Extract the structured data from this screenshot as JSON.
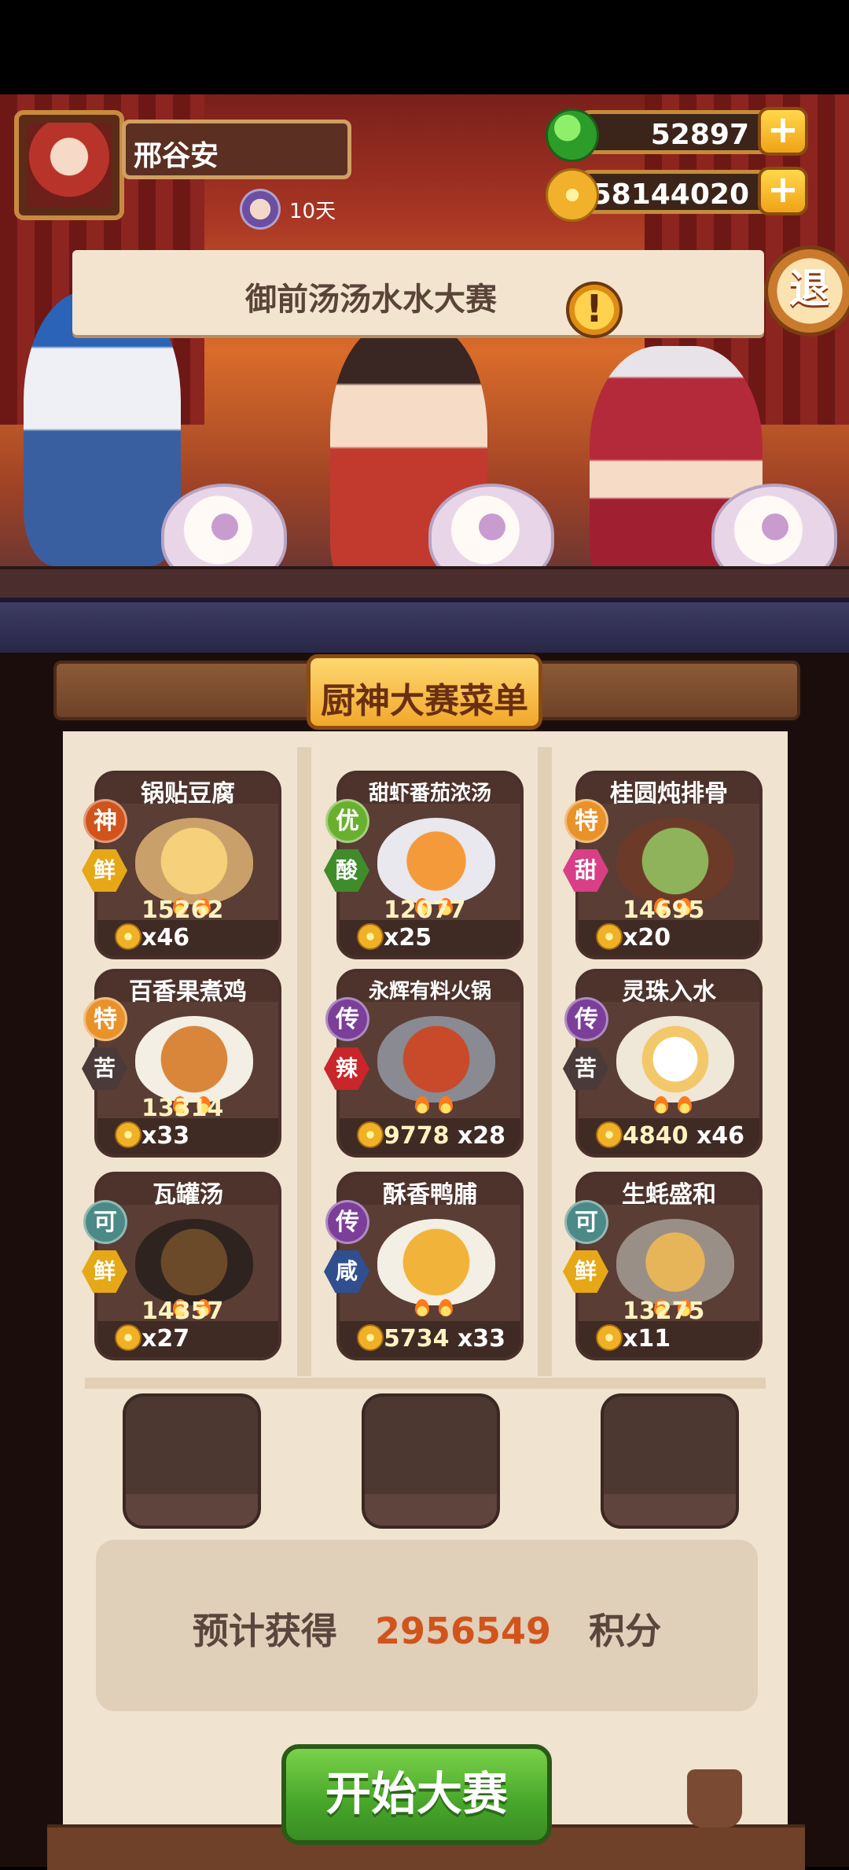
{
  "player": {
    "name": "邢谷安",
    "days": "10天"
  },
  "currency": {
    "jade": "52897",
    "coins": "58144020",
    "plus_label": "+"
  },
  "exit_label": "退",
  "banner": {
    "title": "御前汤汤水水大赛",
    "alert": "!"
  },
  "menu_title": "厨神大赛菜单",
  "dishes": [
    {
      "name": "锅贴豆腐",
      "rank": "神",
      "flavor": "鲜",
      "price": "15262",
      "qty": "x46",
      "rank_color": "#d1541c",
      "flavor_color": "#e6a817"
    },
    {
      "name": "甜虾番茄浓汤",
      "rank": "优",
      "flavor": "酸",
      "price": "12077",
      "qty": "x25",
      "rank_color": "#6ab02f",
      "flavor_color": "#3f8c2a"
    },
    {
      "name": "桂圆炖排骨",
      "rank": "特",
      "flavor": "甜",
      "price": "14695",
      "qty": "x20",
      "rank_color": "#e9922a",
      "flavor_color": "#d83f86"
    },
    {
      "name": "百香果煮鸡",
      "rank": "特",
      "flavor": "苦",
      "price": "13314",
      "qty": "x33",
      "rank_color": "#e9922a",
      "flavor_color": "#4a3b3a"
    },
    {
      "name": "永辉有料火锅",
      "rank": "传",
      "flavor": "辣",
      "price": "9778",
      "qty": "x28",
      "rank_color": "#7b3f9a",
      "flavor_color": "#c8262a"
    },
    {
      "name": "灵珠入水",
      "rank": "传",
      "flavor": "苦",
      "price": "4840",
      "qty": "x46",
      "rank_color": "#7b3f9a",
      "flavor_color": "#4a3b3a"
    },
    {
      "name": "瓦罐汤",
      "rank": "可",
      "flavor": "鲜",
      "price": "14357",
      "qty": "x27",
      "rank_color": "#4b8a86",
      "flavor_color": "#e6a817"
    },
    {
      "name": "酥香鸭脯",
      "rank": "传",
      "flavor": "咸",
      "price": "5734",
      "qty": "x33",
      "rank_color": "#7b3f9a",
      "flavor_color": "#2f4f8f"
    },
    {
      "name": "生蚝盛和",
      "rank": "可",
      "flavor": "鲜",
      "price": "13275",
      "qty": "x11",
      "rank_color": "#4b8a86",
      "flavor_color": "#e6a817"
    }
  ],
  "estimate": {
    "prefix": "预计获得",
    "value": "2956549",
    "suffix": "积分"
  },
  "start_button": "开始大赛"
}
